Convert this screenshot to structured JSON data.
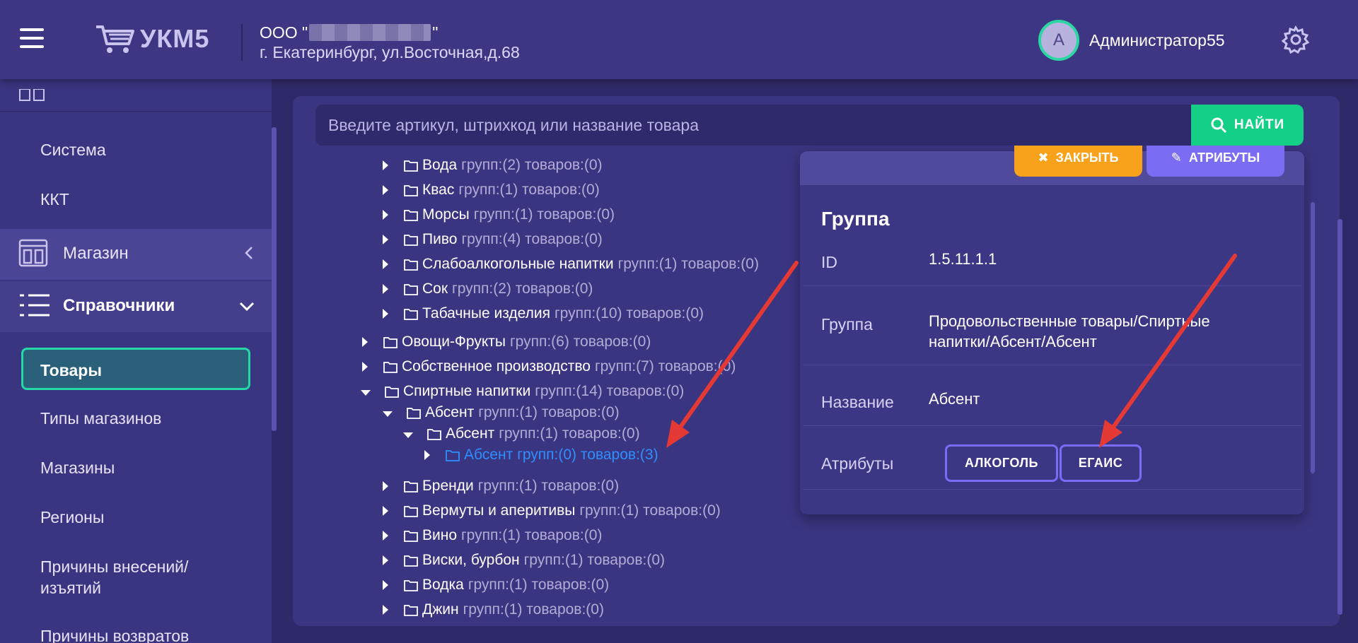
{
  "header": {
    "logo_text": "УКМ5",
    "company_prefix": "ООО \"",
    "company_suffix": "\"",
    "company_address": "г. Екатеринбург, ул.Восточная,д.68",
    "avatar_letter": "А",
    "username": "Администратор55"
  },
  "sidebar": {
    "items_top": [
      {
        "label": "Система"
      },
      {
        "label": "ККТ"
      }
    ],
    "section_shop": "Магазин",
    "section_refs": "Справочники",
    "active_item": "Товары",
    "items": [
      {
        "label": "Типы магазинов"
      },
      {
        "label": "Магазины"
      },
      {
        "label": "Регионы"
      },
      {
        "label": "Причины внесений/"
      },
      {
        "label": "изъятий"
      },
      {
        "label": "Причины возвратов"
      }
    ]
  },
  "search": {
    "placeholder": "Введите артикул, штрихкод или название товара",
    "button_label": "НАЙТИ"
  },
  "tree": [
    {
      "name": "Вода",
      "counts": "групп:(2) товаров:(0)"
    },
    {
      "name": "Квас",
      "counts": "групп:(1) товаров:(0)"
    },
    {
      "name": "Морсы",
      "counts": "групп:(1) товаров:(0)"
    },
    {
      "name": "Пиво",
      "counts": "групп:(4) товаров:(0)"
    },
    {
      "name": "Слабоалкогольные напитки",
      "counts": "групп:(1) товаров:(0)"
    },
    {
      "name": "Сок",
      "counts": "групп:(2) товаров:(0)"
    },
    {
      "name": "Табачные изделия",
      "counts": "групп:(10) товаров:(0)"
    },
    {
      "name": "Овощи-Фрукты",
      "counts": "групп:(6) товаров:(0)"
    },
    {
      "name": "Собственное производство",
      "counts": "групп:(7) товаров:(0)"
    },
    {
      "name": "Спиртные напитки",
      "counts": "групп:(14) товаров:(0)"
    },
    {
      "name": "Абсент",
      "counts": "групп:(1) товаров:(0)"
    },
    {
      "name": "Абсент",
      "counts": "групп:(1) товаров:(0)"
    },
    {
      "name": "Абсент",
      "counts": "групп:(0) товаров:(3)"
    },
    {
      "name": "Бренди",
      "counts": "групп:(1) товаров:(0)"
    },
    {
      "name": "Вермуты и аперитивы",
      "counts": "групп:(1) товаров:(0)"
    },
    {
      "name": "Вино",
      "counts": "групп:(1) товаров:(0)"
    },
    {
      "name": "Виски, бурбон",
      "counts": "групп:(1) товаров:(0)"
    },
    {
      "name": "Водка",
      "counts": "групп:(1) товаров:(0)"
    },
    {
      "name": "Джин",
      "counts": "групп:(1) товаров:(0)"
    }
  ],
  "detail": {
    "close_label": "ЗАКРЫТЬ",
    "attrs_label": "АТРИБУТЫ",
    "title": "Группа",
    "id_label": "ID",
    "id_value": "1.5.11.1.1",
    "group_label": "Группа",
    "group_value_1": "Продовольственные товары/Спиртные",
    "group_value_2": "напитки/Абсент/Абсент",
    "name_label": "Название",
    "name_value": "Абсент",
    "attributes_label": "Атрибуты",
    "chips": [
      "АЛКОГОЛЬ",
      "ЕГАИС"
    ]
  },
  "colors": {
    "accent_green": "#14cf86",
    "accent_orange": "#f7a21a",
    "accent_violet": "#7b6cf4",
    "selected_blue": "#2f8fff",
    "annotation_red": "#e53935"
  }
}
